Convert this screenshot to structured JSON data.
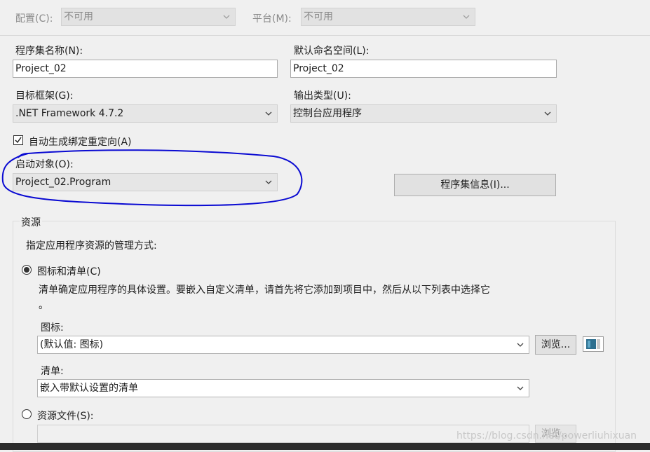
{
  "top": {
    "config_label": "配置(C):",
    "config_value": "不可用",
    "platform_label": "平台(M):",
    "platform_value": "不可用"
  },
  "assembly": {
    "name_label": "程序集名称(N):",
    "name_value": "Project_02",
    "namespace_label": "默认命名空间(L):",
    "namespace_value": "Project_02"
  },
  "framework": {
    "label": "目标框架(G):",
    "value": ".NET Framework 4.7.2",
    "output_label": "输出类型(U):",
    "output_value": "控制台应用程序"
  },
  "binding": {
    "label": "自动生成绑定重定向(A)",
    "checked": true
  },
  "startup": {
    "label": "启动对象(O):",
    "value": "Project_02.Program",
    "assembly_info_button": "程序集信息(I)..."
  },
  "resources": {
    "title": "资源",
    "description": "指定应用程序资源的管理方式:",
    "option_icon_manifest": "图标和清单(C)",
    "option_icon_manifest_desc_line1": "清单确定应用程序的具体设置。要嵌入自定义清单，请首先将它添加到项目中，然后从以下列表中选择它",
    "option_icon_manifest_desc_line2": "。",
    "icon_label": "图标:",
    "icon_value": "(默认值: 图标)",
    "browse_button": "浏览...",
    "manifest_label": "清单:",
    "manifest_value": "嵌入带默认设置的清单",
    "option_resource_file": "资源文件(S):",
    "browse_button_disabled": "浏览..."
  },
  "watermark": "https://blog.csdn.net/powerliuhixuan",
  "colors": {
    "annotation": "#0a0ad2",
    "background": "#f0f0f0"
  }
}
